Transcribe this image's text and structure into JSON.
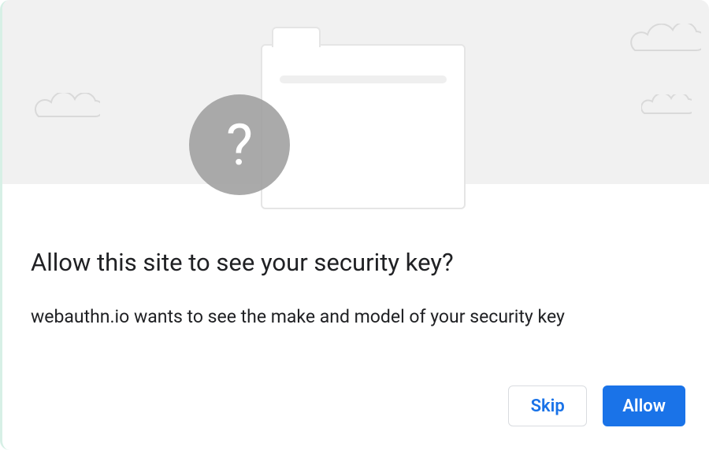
{
  "hero": {
    "avatar_glyph": "?"
  },
  "dialog": {
    "title": "Allow this site to see your security key?",
    "description": "webauthn.io wants to see the make and model of your security key"
  },
  "buttons": {
    "skip": "Skip",
    "allow": "Allow"
  }
}
